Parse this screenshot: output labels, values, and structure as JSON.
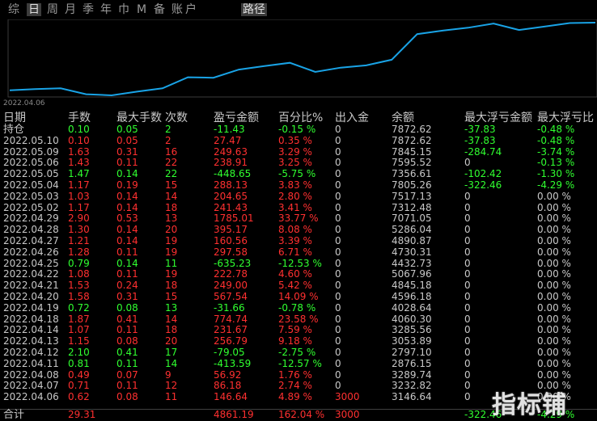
{
  "tabs": {
    "items": [
      "综",
      "日",
      "周",
      "月",
      "季",
      "年",
      "巾",
      "M",
      "备",
      "账",
      "户"
    ],
    "active": "日",
    "route": "路径"
  },
  "chart": {
    "start_date": "2022.04.06",
    "line_color": "#19a3e6",
    "values": [
      3146.64,
      3232.82,
      3289.74,
      2876.15,
      2797.1,
      3053.89,
      3285.56,
      4060.3,
      4028.64,
      4596.18,
      4845.18,
      5067.96,
      4432.73,
      4730.31,
      4890.87,
      5286.04,
      7071.05,
      7312.48,
      7517.13,
      7805.26,
      7356.61,
      7595.52,
      7845.15,
      7872.62
    ]
  },
  "headers": [
    "日期",
    "手数",
    "最大手数",
    "次数",
    "盈亏金额",
    "百分比%",
    "出入金",
    "余额",
    "最大浮亏金额",
    "最大浮亏比"
  ],
  "position_row": {
    "date": "持仓",
    "lots": "0.10",
    "maxlots": "0.05",
    "count": "2",
    "pnl": "-11.43",
    "pct": "-0.15 %",
    "flow": "0",
    "balance": "7872.62",
    "maxfloat": "-37.83",
    "maxfloatpct": "-0.48 %",
    "tone": "g"
  },
  "rows": [
    {
      "date": "2022.05.10",
      "lots": "0.10",
      "maxlots": "0.05",
      "count": "2",
      "pnl": "27.47",
      "pct": "0.35 %",
      "flow": "0",
      "balance": "7872.62",
      "maxfloat": "-37.83",
      "maxfloatpct": "-0.48 %",
      "tone": "r"
    },
    {
      "date": "2022.05.09",
      "lots": "1.63",
      "maxlots": "0.31",
      "count": "16",
      "pnl": "249.63",
      "pct": "3.29 %",
      "flow": "0",
      "balance": "7845.15",
      "maxfloat": "-284.74",
      "maxfloatpct": "-3.74 %",
      "tone": "r"
    },
    {
      "date": "2022.05.06",
      "lots": "1.43",
      "maxlots": "0.11",
      "count": "22",
      "pnl": "238.91",
      "pct": "3.25 %",
      "flow": "0",
      "balance": "7595.52",
      "maxfloat": "0",
      "maxfloatpct": "-0.13 %",
      "tone": "r"
    },
    {
      "date": "2022.05.05",
      "lots": "1.47",
      "maxlots": "0.14",
      "count": "22",
      "pnl": "-448.65",
      "pct": "-5.75 %",
      "flow": "0",
      "balance": "7356.61",
      "maxfloat": "-102.42",
      "maxfloatpct": "-1.30 %",
      "tone": "g"
    },
    {
      "date": "2022.05.04",
      "lots": "1.17",
      "maxlots": "0.19",
      "count": "15",
      "pnl": "288.13",
      "pct": "3.83 %",
      "flow": "0",
      "balance": "7805.26",
      "maxfloat": "-322.46",
      "maxfloatpct": "-4.29 %",
      "tone": "r"
    },
    {
      "date": "2022.05.03",
      "lots": "1.03",
      "maxlots": "0.14",
      "count": "14",
      "pnl": "204.65",
      "pct": "2.80 %",
      "flow": "0",
      "balance": "7517.13",
      "maxfloat": "0",
      "maxfloatpct": "0.00 %",
      "tone": "r"
    },
    {
      "date": "2022.05.02",
      "lots": "1.17",
      "maxlots": "0.14",
      "count": "18",
      "pnl": "241.43",
      "pct": "3.41 %",
      "flow": "0",
      "balance": "7312.48",
      "maxfloat": "0",
      "maxfloatpct": "0.00 %",
      "tone": "r"
    },
    {
      "date": "2022.04.29",
      "lots": "2.90",
      "maxlots": "0.53",
      "count": "13",
      "pnl": "1785.01",
      "pct": "33.77 %",
      "flow": "0",
      "balance": "7071.05",
      "maxfloat": "0",
      "maxfloatpct": "0.00 %",
      "tone": "r"
    },
    {
      "date": "2022.04.28",
      "lots": "1.30",
      "maxlots": "0.14",
      "count": "20",
      "pnl": "395.17",
      "pct": "8.08 %",
      "flow": "0",
      "balance": "5286.04",
      "maxfloat": "0",
      "maxfloatpct": "0.00 %",
      "tone": "r"
    },
    {
      "date": "2022.04.27",
      "lots": "1.21",
      "maxlots": "0.14",
      "count": "19",
      "pnl": "160.56",
      "pct": "3.39 %",
      "flow": "0",
      "balance": "4890.87",
      "maxfloat": "0",
      "maxfloatpct": "0.00 %",
      "tone": "r"
    },
    {
      "date": "2022.04.26",
      "lots": "1.28",
      "maxlots": "0.11",
      "count": "19",
      "pnl": "297.58",
      "pct": "6.71 %",
      "flow": "0",
      "balance": "4730.31",
      "maxfloat": "0",
      "maxfloatpct": "0.00 %",
      "tone": "r"
    },
    {
      "date": "2022.04.25",
      "lots": "0.79",
      "maxlots": "0.14",
      "count": "11",
      "pnl": "-635.23",
      "pct": "-12.53 %",
      "flow": "0",
      "balance": "4432.73",
      "maxfloat": "0",
      "maxfloatpct": "0.00 %",
      "tone": "g"
    },
    {
      "date": "2022.04.22",
      "lots": "1.08",
      "maxlots": "0.11",
      "count": "19",
      "pnl": "222.78",
      "pct": "4.60 %",
      "flow": "0",
      "balance": "5067.96",
      "maxfloat": "0",
      "maxfloatpct": "0.00 %",
      "tone": "r"
    },
    {
      "date": "2022.04.21",
      "lots": "1.53",
      "maxlots": "0.24",
      "count": "18",
      "pnl": "249.00",
      "pct": "5.42 %",
      "flow": "0",
      "balance": "4845.18",
      "maxfloat": "0",
      "maxfloatpct": "0.00 %",
      "tone": "r"
    },
    {
      "date": "2022.04.20",
      "lots": "1.58",
      "maxlots": "0.31",
      "count": "15",
      "pnl": "567.54",
      "pct": "14.09 %",
      "flow": "0",
      "balance": "4596.18",
      "maxfloat": "0",
      "maxfloatpct": "0.00 %",
      "tone": "r"
    },
    {
      "date": "2022.04.19",
      "lots": "0.72",
      "maxlots": "0.08",
      "count": "13",
      "pnl": "-31.66",
      "pct": "-0.78 %",
      "flow": "0",
      "balance": "4028.64",
      "maxfloat": "0",
      "maxfloatpct": "0.00 %",
      "tone": "g"
    },
    {
      "date": "2022.04.18",
      "lots": "1.87",
      "maxlots": "0.41",
      "count": "14",
      "pnl": "774.74",
      "pct": "23.58 %",
      "flow": "0",
      "balance": "4060.30",
      "maxfloat": "0",
      "maxfloatpct": "0.00 %",
      "tone": "r"
    },
    {
      "date": "2022.04.14",
      "lots": "1.07",
      "maxlots": "0.11",
      "count": "18",
      "pnl": "231.67",
      "pct": "7.59 %",
      "flow": "0",
      "balance": "3285.56",
      "maxfloat": "0",
      "maxfloatpct": "0.00 %",
      "tone": "r"
    },
    {
      "date": "2022.04.13",
      "lots": "1.15",
      "maxlots": "0.08",
      "count": "20",
      "pnl": "256.79",
      "pct": "9.18 %",
      "flow": "0",
      "balance": "3053.89",
      "maxfloat": "0",
      "maxfloatpct": "0.00 %",
      "tone": "r"
    },
    {
      "date": "2022.04.12",
      "lots": "2.10",
      "maxlots": "0.41",
      "count": "17",
      "pnl": "-79.05",
      "pct": "-2.75 %",
      "flow": "0",
      "balance": "2797.10",
      "maxfloat": "0",
      "maxfloatpct": "0.00 %",
      "tone": "g"
    },
    {
      "date": "2022.04.11",
      "lots": "0.81",
      "maxlots": "0.11",
      "count": "14",
      "pnl": "-413.59",
      "pct": "-12.57 %",
      "flow": "0",
      "balance": "2876.15",
      "maxfloat": "0",
      "maxfloatpct": "0.00 %",
      "tone": "g"
    },
    {
      "date": "2022.04.08",
      "lots": "0.49",
      "maxlots": "0.07",
      "count": "9",
      "pnl": "56.92",
      "pct": "1.76 %",
      "flow": "0",
      "balance": "3289.74",
      "maxfloat": "0",
      "maxfloatpct": "0.00 %",
      "tone": "r"
    },
    {
      "date": "2022.04.07",
      "lots": "0.71",
      "maxlots": "0.11",
      "count": "12",
      "pnl": "86.18",
      "pct": "2.74 %",
      "flow": "0",
      "balance": "3232.82",
      "maxfloat": "0",
      "maxfloatpct": "0.00 %",
      "tone": "r"
    },
    {
      "date": "2022.04.06",
      "lots": "0.62",
      "maxlots": "0.08",
      "count": "11",
      "pnl": "146.64",
      "pct": "4.89 %",
      "flow": "3000",
      "balance": "3146.64",
      "maxfloat": "0",
      "maxfloatpct": "0.00 %",
      "tone": "r"
    }
  ],
  "total": {
    "label": "合计",
    "lots": "29.31",
    "pnl": "4861.19",
    "pct": "162.04 %",
    "flow": "3000",
    "maxfloat": "-322.46",
    "maxfloatpct": "-4.29 %"
  },
  "watermark": "指标铺",
  "colors": {
    "up": "#ff3030",
    "down": "#30ff30",
    "text": "#c8c8c8",
    "bg": "#000000",
    "line": "#19a3e6"
  }
}
